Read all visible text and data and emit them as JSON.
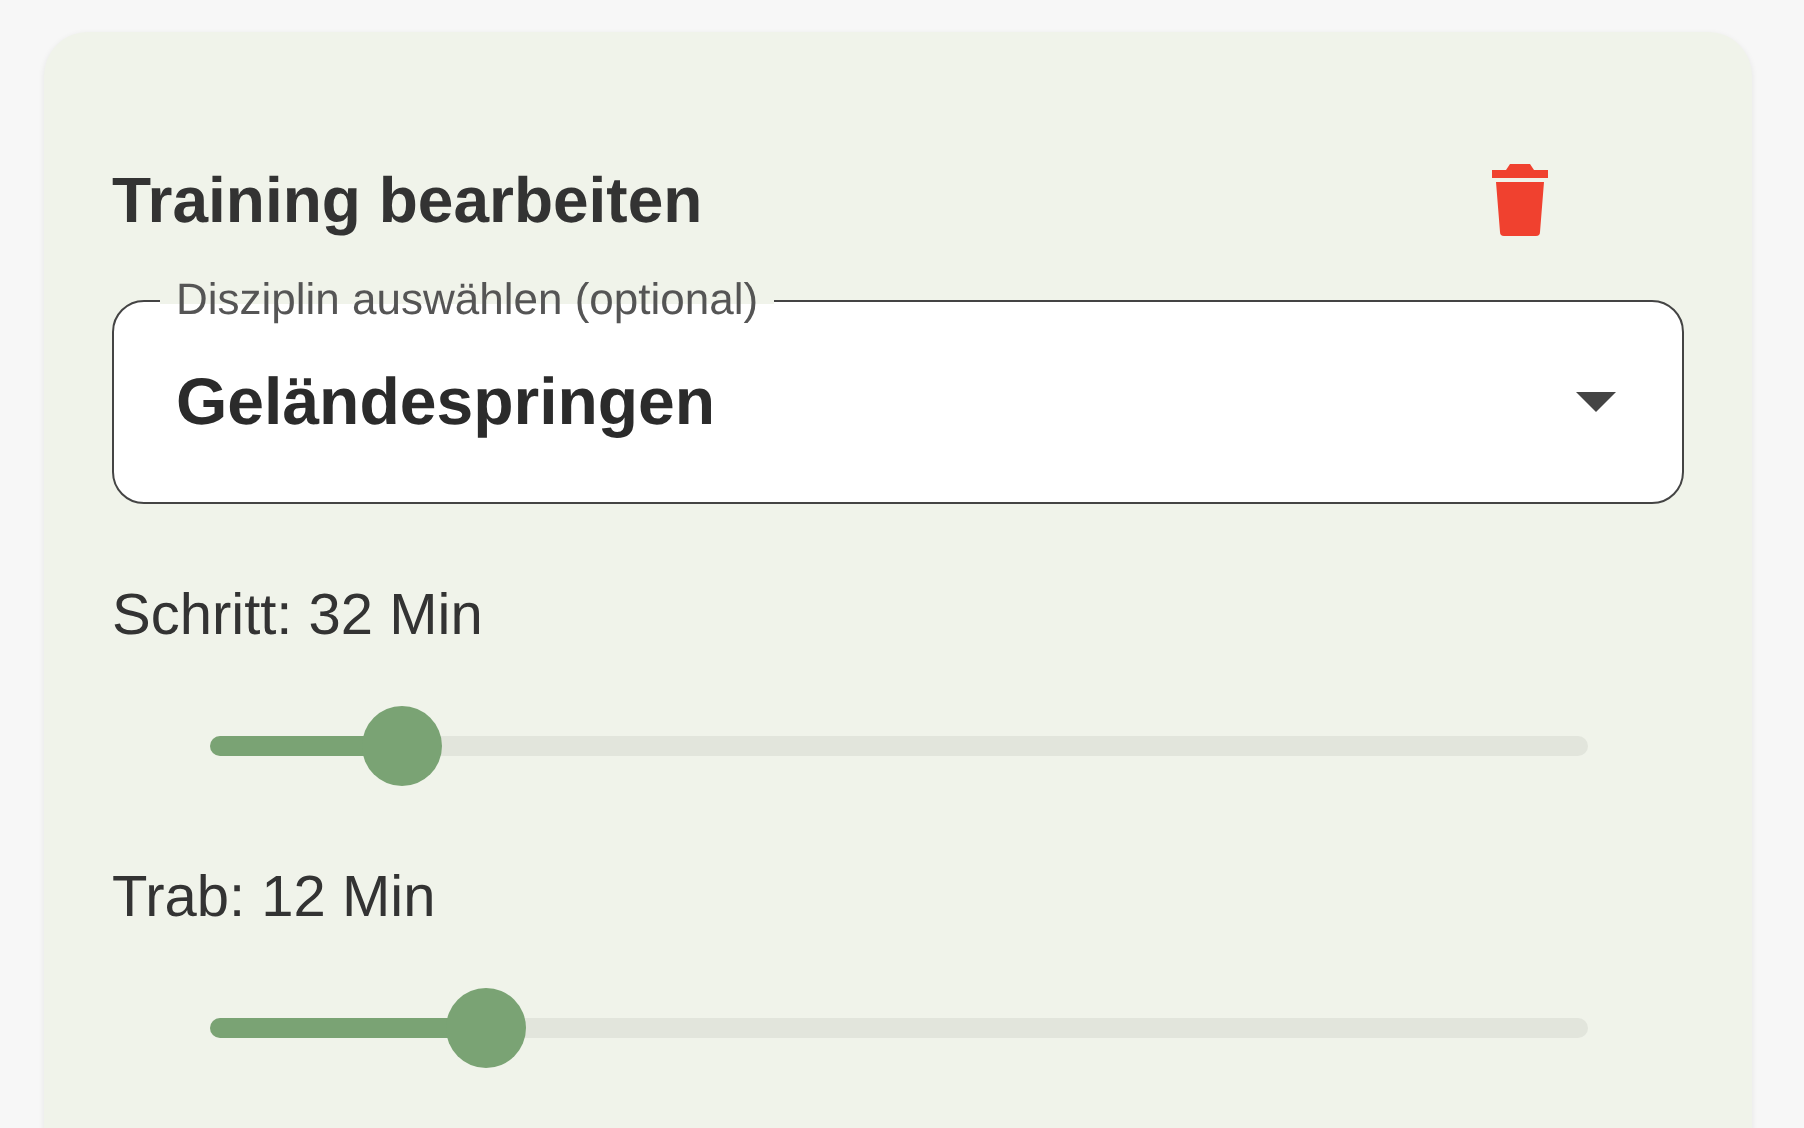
{
  "title": "Training bearbeiten",
  "discipline": {
    "label": "Disziplin auswählen (optional)",
    "value": "Geländespringen"
  },
  "sliders": [
    {
      "label": "Schritt: 32 Min",
      "level": 0.14
    },
    {
      "label": "Trab: 12 Min",
      "level": 0.2
    }
  ]
}
